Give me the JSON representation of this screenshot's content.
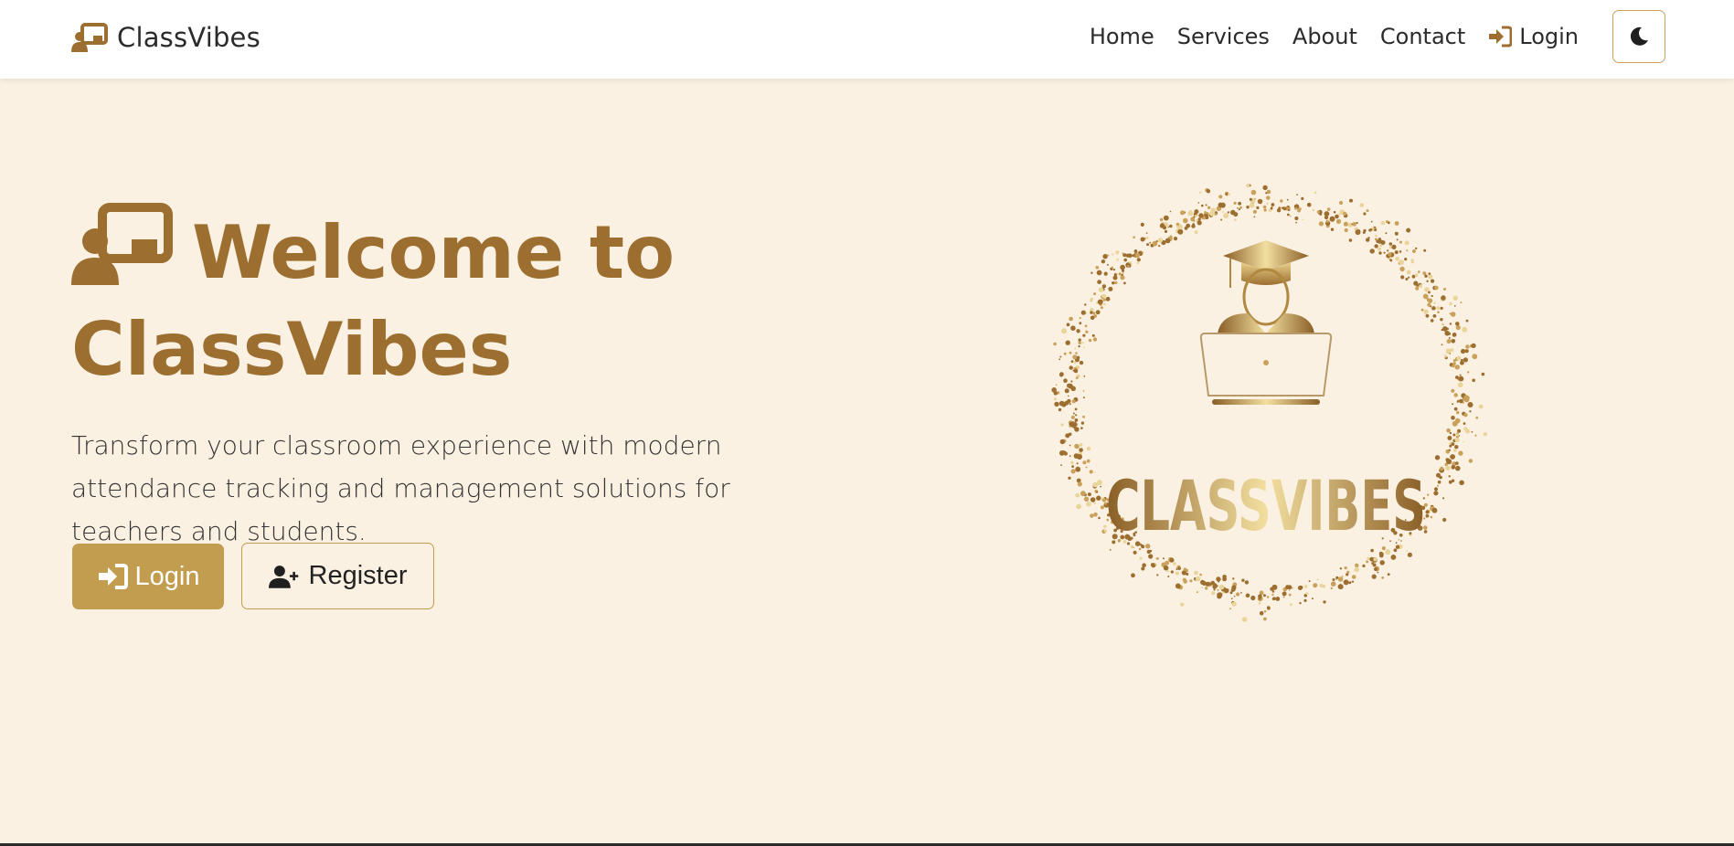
{
  "brand": {
    "name": "ClassVibes",
    "accent_color": "#9c6e2f",
    "icon": "chalkboard-user-icon"
  },
  "nav": {
    "items": [
      {
        "label": "Home"
      },
      {
        "label": "Services"
      },
      {
        "label": "About"
      },
      {
        "label": "Contact"
      }
    ],
    "login_label": "Login",
    "login_icon": "sign-in-icon",
    "theme_toggle_icon": "moon-icon"
  },
  "hero": {
    "title": "Welcome to ClassVibes",
    "title_icon": "chalkboard-user-icon",
    "description": "Transform your classroom experience with modern attendance tracking and management solutions for teachers and students.",
    "login_button": "Login",
    "register_button": "Register",
    "register_icon": "user-plus-icon"
  },
  "logo": {
    "text": "CLASSVIBES",
    "icon": "graduate-laptop-icon"
  },
  "colors": {
    "background": "#fbf1e2",
    "navbar": "#ffffff",
    "primary_button": "#c29d50",
    "gold_light": "#f2dfa0",
    "gold_dark": "#8a5e26"
  }
}
